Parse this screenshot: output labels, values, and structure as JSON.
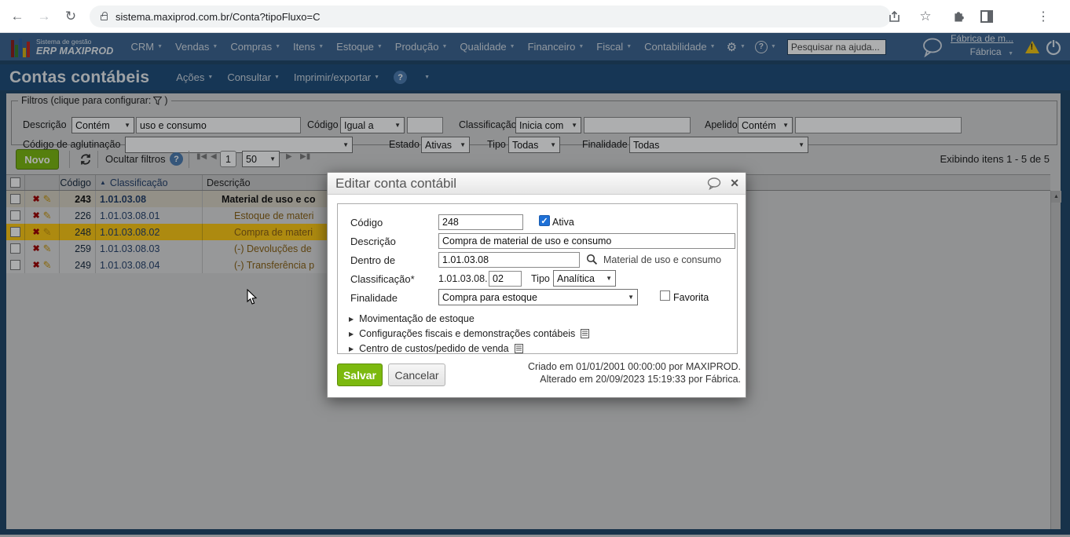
{
  "browser": {
    "url": "sistema.maxiprod.com.br/Conta?tipoFluxo=C"
  },
  "navbar": {
    "logo_top": "Sistema de gestão",
    "logo_main": "ERP MAXIPROD",
    "menus": [
      "CRM",
      "Vendas",
      "Compras",
      "Itens",
      "Estoque",
      "Produção",
      "Qualidade",
      "Financeiro",
      "Fiscal",
      "Contabilidade"
    ],
    "search_placeholder": "Pesquisar na ajuda...",
    "account_link": "Fábrica de m...",
    "account_name": "Fábrica"
  },
  "page": {
    "title": "Contas contábeis",
    "menus": [
      "Ações",
      "Consultar",
      "Imprimir/exportar"
    ]
  },
  "filters": {
    "legend_prefix": "Filtros (clique para configurar:",
    "legend_suffix": ")",
    "descricao_label": "Descrição",
    "descricao_op": "Contém",
    "descricao_value": "uso e consumo",
    "codigo_label": "Código",
    "codigo_op": "Igual a",
    "codigo_value": "",
    "classificacao_label": "Classificação",
    "classificacao_op": "Inicia com",
    "classificacao_value": "",
    "apelido_label": "Apelido",
    "apelido_op": "Contém",
    "apelido_value": "",
    "aglutinacao_label": "Código de aglutinação",
    "aglutinacao_value": "",
    "estado_label": "Estado",
    "estado_value": "Ativas",
    "tipo_label": "Tipo",
    "tipo_value": "Todas",
    "finalidade_label": "Finalidade",
    "finalidade_value": "Todas"
  },
  "toolbar": {
    "novo": "Novo",
    "ocultar_filtros": "Ocultar filtros",
    "page_number": "1",
    "page_size": "50",
    "status": "Exibindo itens 1 - 5 de 5"
  },
  "table": {
    "headers": {
      "codigo": "Código",
      "classificacao": "Classificação",
      "descricao": "Descrição"
    },
    "rows": [
      {
        "codigo": "243",
        "classificacao": "1.01.03.08",
        "descricao": "Material de uso e co",
        "bold": true,
        "selected": false,
        "indent": 1
      },
      {
        "codigo": "226",
        "classificacao": "1.01.03.08.01",
        "descricao": "Estoque de materi",
        "bold": false,
        "selected": false,
        "indent": 2
      },
      {
        "codigo": "248",
        "classificacao": "1.01.03.08.02",
        "descricao": "Compra de materi",
        "bold": false,
        "selected": true,
        "indent": 2
      },
      {
        "codigo": "259",
        "classificacao": "1.01.03.08.03",
        "descricao": "(-) Devoluções de",
        "bold": false,
        "selected": false,
        "indent": 2
      },
      {
        "codigo": "249",
        "classificacao": "1.01.03.08.04",
        "descricao": "(-) Transferência p",
        "bold": false,
        "selected": false,
        "indent": 2
      }
    ]
  },
  "modal": {
    "title": "Editar conta contábil",
    "codigo_label": "Código",
    "codigo_value": "248",
    "ativa_label": "Ativa",
    "descricao_label": "Descrição",
    "descricao_value": "Compra de material de uso e consumo",
    "dentro_label": "Dentro de",
    "dentro_value": "1.01.03.08",
    "dentro_ref": "Material de uso e consumo",
    "classificacao_label": "Classificação*",
    "classificacao_prefix": "1.01.03.08.",
    "classificacao_suffix": "02",
    "tipo_label": "Tipo",
    "tipo_value": "Analítica",
    "finalidade_label": "Finalidade",
    "finalidade_value": "Compra para estoque",
    "favorita_label": "Favorita",
    "sections": [
      {
        "label": "Movimentação de estoque",
        "doc_icon": false
      },
      {
        "label": "Configurações fiscais e demonstrações contábeis",
        "doc_icon": true
      },
      {
        "label": "Centro de custos/pedido de venda",
        "doc_icon": true
      }
    ],
    "save": "Salvar",
    "cancel": "Cancelar",
    "created": "Criado em 01/01/2001 00:00:00 por MAXIPROD.",
    "altered": "Alterado em 20/09/2023 15:19:33 por Fábrica."
  }
}
